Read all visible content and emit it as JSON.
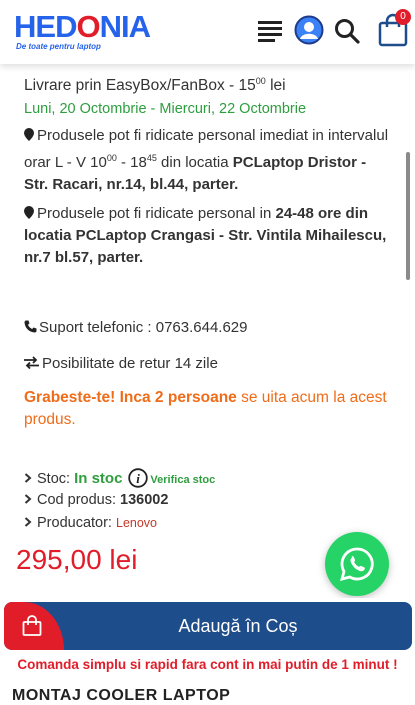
{
  "header": {
    "logo_main_1": "HED",
    "logo_o": "O",
    "logo_main_2": "NIA",
    "logo_tagline": "De toate pentru laptop",
    "cart_count": "0"
  },
  "delivery": {
    "label": "Livrare prin EasyBox/FanBox - 15",
    "price_cents": "00",
    "currency": " lei",
    "dates": "Luni, 20 Octombrie - Miercuri, 22 Octombrie"
  },
  "pickup": {
    "line1_text_a": "Produsele pot fi ridicate personal imediat in intervalul orar L - V 10",
    "line1_sup_a": "00",
    "line1_text_b": " - 18",
    "line1_sup_b": "45",
    "line1_text_c": " din locatia ",
    "line1_location": "PCLaptop Dristor - Str. Racari, nr.14, bl.44, parter.",
    "line2_text_a": "Produsele pot fi ridicate personal in ",
    "line2_location": "24-48 ore din locatia PCLaptop Crangasi - Str. Vintila Mihailescu, nr.7 bl.57, parter."
  },
  "support": {
    "label": "Suport telefonic : 0763.644.629"
  },
  "return_policy": {
    "label": "Posibilitate de retur 14 zile"
  },
  "urgency": {
    "bold": "Grabeste-te! Inca 2 persoane",
    "rest": " se uita acum la acest produs."
  },
  "product": {
    "stock_label": "Stoc: ",
    "stock_value": "In stoc",
    "verify_stock": "Verifica stoc",
    "code_label": "Cod produs: ",
    "code_value": "136002",
    "maker_label": "Producator: ",
    "maker_value": "Lenovo",
    "price": "295,00 lei"
  },
  "cta": {
    "add_to_cart": "Adaugă în Coș",
    "note": "Comanda simplu si rapid fara cont in mai putin de 1 minut !",
    "next_section_title": "MONTAJ COOLER LAPTOP"
  },
  "colors": {
    "brand_blue": "#2563eb",
    "brand_red": "#e11d2a",
    "green": "#2e9e3e",
    "orange": "#ef6c1a",
    "cart_button": "#1e4d8c",
    "whatsapp": "#25d366"
  }
}
